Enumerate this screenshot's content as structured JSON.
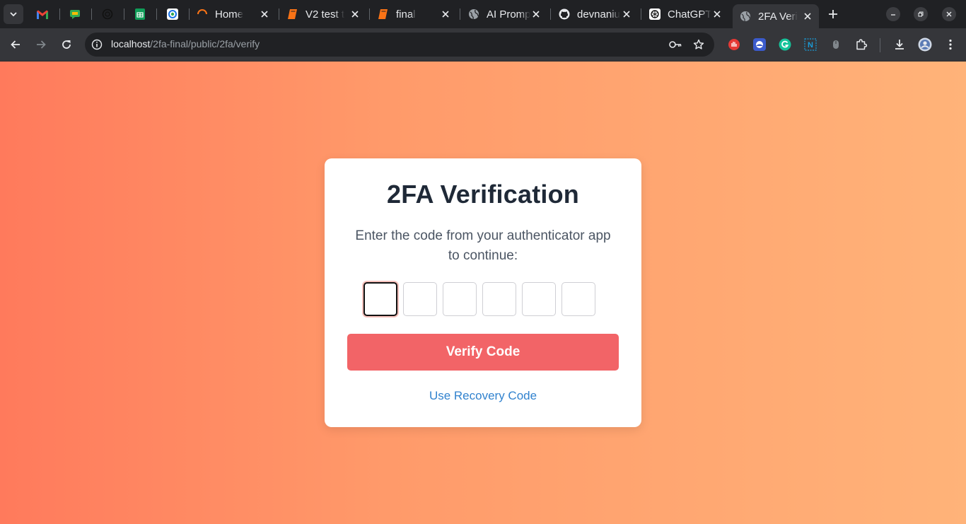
{
  "browser": {
    "tabs": [
      {
        "title": "",
        "icon": "gmail-icon"
      },
      {
        "title": "",
        "icon": "chat-icon"
      },
      {
        "title": "",
        "icon": "openai-icon"
      },
      {
        "title": "",
        "icon": "sheets-icon"
      },
      {
        "title": "",
        "icon": "drive-sync-icon"
      },
      {
        "title": "Home",
        "icon": "loader-icon"
      },
      {
        "title": "V2 test t",
        "icon": "book-icon"
      },
      {
        "title": "final",
        "icon": "book-icon"
      },
      {
        "title": "AI Promp",
        "icon": "globe-icon"
      },
      {
        "title": "devnaniu",
        "icon": "github-icon"
      },
      {
        "title": "ChatGPT",
        "icon": "chatgpt-icon"
      },
      {
        "title": "2FA Veri",
        "icon": "globe-icon",
        "active": true
      }
    ],
    "url_host": "localhost",
    "url_path": "/2fa-final/public/2fa/verify",
    "colors": {
      "tabstrip": "#202124",
      "toolbar": "#35363a"
    }
  },
  "page": {
    "title": "2FA Verification",
    "description": "Enter the code from your authenticator app to continue:",
    "code_digits": [
      "",
      "",
      "",
      "",
      "",
      ""
    ],
    "verify_label": "Verify Code",
    "recovery_label": "Use Recovery Code",
    "colors": {
      "gradient_start": "#ff7a5c",
      "gradient_end": "#ffb379",
      "button": "#f26467",
      "link": "#3182ce",
      "heading": "#1f2937"
    }
  }
}
